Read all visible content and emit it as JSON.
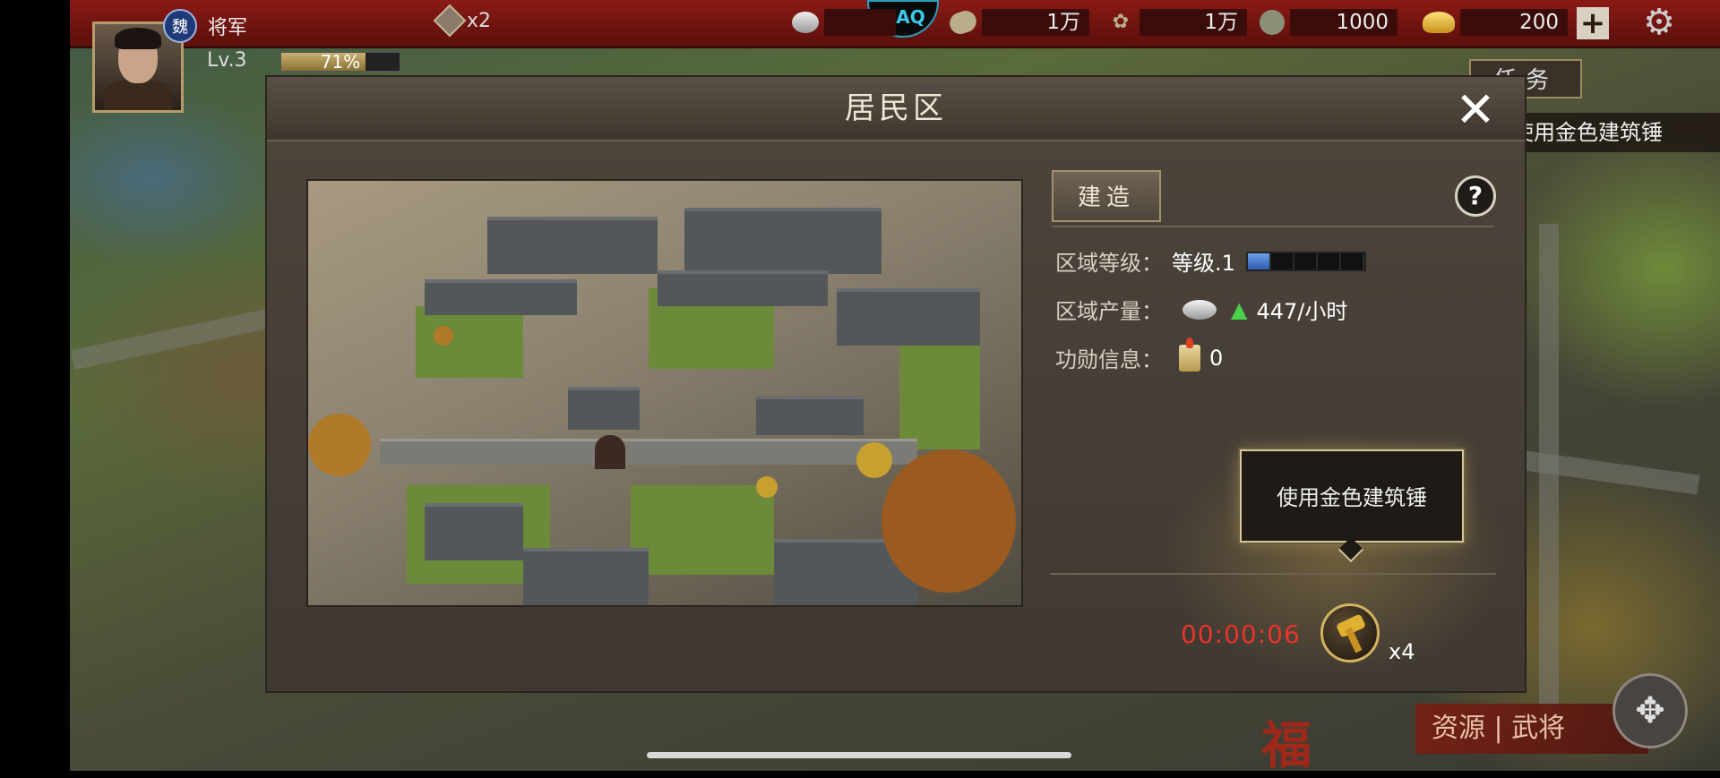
{
  "player": {
    "faction_badge": "魏",
    "name": "将军",
    "level": "Lv.3",
    "xp_percent": 71,
    "xp_label": "71%",
    "boost": "x2"
  },
  "resources": [
    {
      "icon": "silver-ingot-icon",
      "value": ""
    },
    {
      "icon": "wood-log-icon",
      "value": "1万"
    },
    {
      "icon": "grain-icon",
      "value": "1万"
    },
    {
      "icon": "stone-icon",
      "value": "1000"
    },
    {
      "icon": "gold-ingot-icon",
      "value": "200"
    }
  ],
  "quest": {
    "tab_label": "任务",
    "banner": "使用金色建筑锤"
  },
  "dialog": {
    "title": "居民区",
    "close_label": "✕",
    "build_tab": "建造",
    "help_label": "?",
    "info": {
      "level_label": "区域等级：",
      "level_value": "等级.1",
      "level_filled": 1,
      "level_total": 5,
      "output_label": "区域产量：",
      "output_value": "447/小时",
      "merit_label": "功勋信息：",
      "merit_value": "0"
    },
    "tooltip": "使用金色建筑锤",
    "timer": "00:00:06",
    "hammer_count": "x4"
  },
  "bottom": {
    "tabs_label": "资源 | 武将",
    "fu_char": "福"
  },
  "colors": {
    "accent_red": "#e8342a",
    "level_blue": "#2f5cb0",
    "topbar_red": "#8a1a15"
  }
}
